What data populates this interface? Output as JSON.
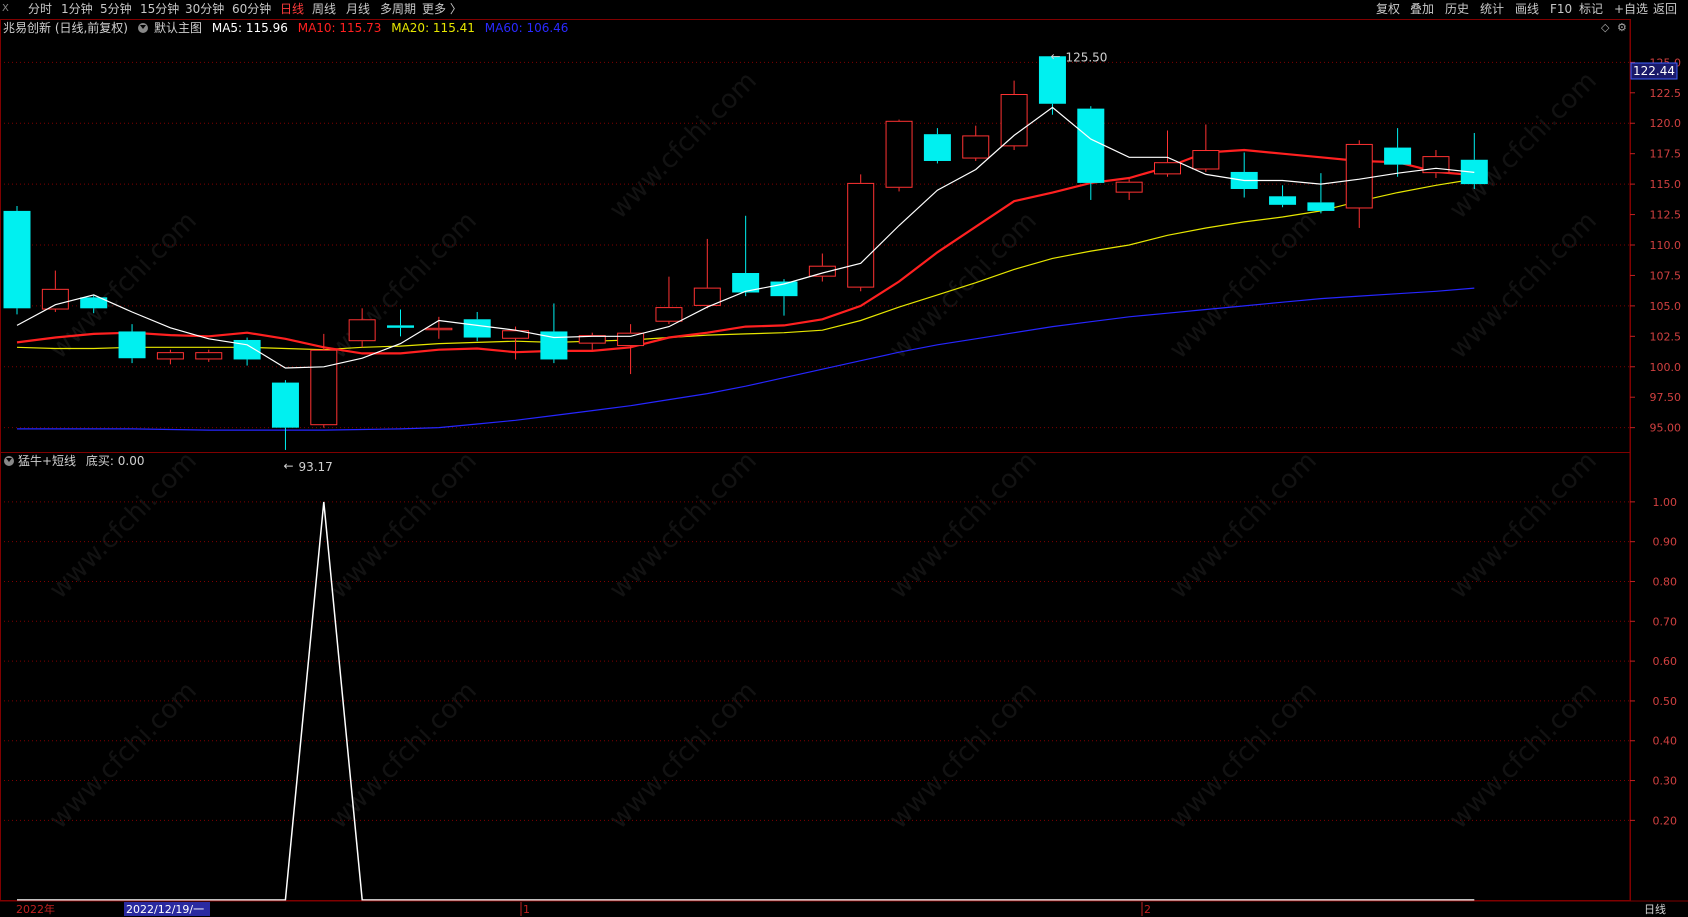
{
  "toolbar": {
    "corner": "X",
    "left_items": [
      "分时",
      "1分钟",
      "5分钟",
      "15分钟",
      "30分钟",
      "60分钟",
      "日线",
      "周线",
      "月线",
      "多周期",
      "更多 〉"
    ],
    "active": "日线",
    "right_items": [
      "复权",
      "叠加",
      "历史",
      "统计",
      "画线",
      "F10",
      "标记",
      "+自选",
      "返回"
    ]
  },
  "infobar": {
    "stock": "兆易创新 (日线,前复权)",
    "main": "默认主图",
    "ma5": "MA5: 115.96",
    "ma10": "MA10: 115.73",
    "ma20": "MA20: 115.41",
    "ma60": "MA60: 106.46"
  },
  "colors": {
    "up": "#ff3232",
    "down": "#00f0f0",
    "ma5": "#ffffff",
    "ma10": "#ff2020",
    "ma20": "#e6e600",
    "ma60": "#2626ff",
    "grid": "#800000",
    "indicator": "#ffffff"
  },
  "price_panel": {
    "current_price": "122.44",
    "high_label": "125.50",
    "low_label": "93.17",
    "yticks": [
      "125.0",
      "122.5",
      "120.0",
      "117.5",
      "115.0",
      "112.5",
      "110.0",
      "107.5",
      "105.0",
      "102.5",
      "100.0",
      "97.50",
      "95.00"
    ]
  },
  "indicator_panel": {
    "title": "猛牛+短线",
    "value": "底买: 0.00",
    "yticks": [
      "1.00",
      "0.90",
      "0.80",
      "0.70",
      "0.60",
      "0.50",
      "0.40",
      "0.30",
      "0.20"
    ]
  },
  "xaxis": {
    "year": "2022年",
    "cursor_date": "2022/12/19/一",
    "month1": "1",
    "month2": "2",
    "period": "日线"
  },
  "watermark": "www.cfchi.com",
  "chart_data": {
    "type": "candlestick",
    "ylim": [
      93.0,
      127.0
    ],
    "candles": [
      {
        "o": 112.8,
        "c": 104.8,
        "h": 113.2,
        "l": 104.3
      },
      {
        "o": 104.7,
        "c": 106.4,
        "h": 107.9,
        "l": 104.5
      },
      {
        "o": 105.7,
        "c": 104.8,
        "h": 105.9,
        "l": 104.4
      },
      {
        "o": 102.9,
        "c": 100.7,
        "h": 103.5,
        "l": 100.3
      },
      {
        "o": 100.6,
        "c": 101.2,
        "h": 101.4,
        "l": 100.2
      },
      {
        "o": 100.6,
        "c": 101.2,
        "h": 101.4,
        "l": 100.4
      },
      {
        "o": 102.2,
        "c": 100.6,
        "h": 102.4,
        "l": 100.1
      },
      {
        "o": 98.7,
        "c": 95.0,
        "h": 98.9,
        "l": 93.17
      },
      {
        "o": 95.2,
        "c": 101.4,
        "h": 102.7,
        "l": 95.0
      },
      {
        "o": 102.1,
        "c": 103.9,
        "h": 104.8,
        "l": 101.6
      },
      {
        "o": 103.4,
        "c": 103.2,
        "h": 104.7,
        "l": 102.5
      },
      {
        "o": 103.0,
        "c": 103.2,
        "h": 104.1,
        "l": 102.3
      },
      {
        "o": 103.9,
        "c": 102.4,
        "h": 104.5,
        "l": 102.1
      },
      {
        "o": 102.3,
        "c": 103.0,
        "h": 103.3,
        "l": 100.6
      },
      {
        "o": 102.9,
        "c": 100.6,
        "h": 105.2,
        "l": 100.3
      },
      {
        "o": 101.9,
        "c": 102.6,
        "h": 102.8,
        "l": 101.4
      },
      {
        "o": 101.7,
        "c": 102.8,
        "h": 103.5,
        "l": 99.4
      },
      {
        "o": 103.7,
        "c": 104.9,
        "h": 107.4,
        "l": 103.5
      },
      {
        "o": 105.0,
        "c": 106.5,
        "h": 110.5,
        "l": 104.8
      },
      {
        "o": 107.7,
        "c": 106.1,
        "h": 112.4,
        "l": 105.8
      },
      {
        "o": 107.0,
        "c": 105.8,
        "h": 107.2,
        "l": 104.2
      },
      {
        "o": 107.4,
        "c": 108.3,
        "h": 109.3,
        "l": 107.0
      },
      {
        "o": 106.5,
        "c": 115.1,
        "h": 115.8,
        "l": 106.2
      },
      {
        "o": 114.7,
        "c": 120.2,
        "h": 120.3,
        "l": 114.4
      },
      {
        "o": 119.1,
        "c": 116.9,
        "h": 119.6,
        "l": 116.7
      },
      {
        "o": 117.1,
        "c": 119.0,
        "h": 119.8,
        "l": 116.9
      },
      {
        "o": 118.1,
        "c": 122.4,
        "h": 123.5,
        "l": 117.8
      },
      {
        "o": 125.5,
        "c": 121.6,
        "h": 125.5,
        "l": 120.7
      },
      {
        "o": 121.2,
        "c": 115.1,
        "h": 121.4,
        "l": 113.7
      },
      {
        "o": 114.3,
        "c": 115.2,
        "h": 115.4,
        "l": 113.7
      },
      {
        "o": 115.8,
        "c": 116.8,
        "h": 119.4,
        "l": 115.6
      },
      {
        "o": 116.2,
        "c": 117.8,
        "h": 119.9,
        "l": 116.0
      },
      {
        "o": 116.0,
        "c": 114.6,
        "h": 117.6,
        "l": 113.9
      },
      {
        "o": 114.0,
        "c": 113.3,
        "h": 114.9,
        "l": 113.1
      },
      {
        "o": 113.5,
        "c": 112.8,
        "h": 115.9,
        "l": 112.6
      },
      {
        "o": 113.0,
        "c": 118.3,
        "h": 118.6,
        "l": 111.4
      },
      {
        "o": 118.0,
        "c": 116.6,
        "h": 119.6,
        "l": 115.6
      },
      {
        "o": 115.9,
        "c": 117.3,
        "h": 117.8,
        "l": 115.5
      },
      {
        "o": 117.0,
        "c": 115.0,
        "h": 119.2,
        "l": 114.6
      }
    ],
    "ma5": [
      103.4,
      105.1,
      105.9,
      104.5,
      103.2,
      102.3,
      101.8,
      99.9,
      100.0,
      100.7,
      101.9,
      103.8,
      103.4,
      103.0,
      102.4,
      102.5,
      102.5,
      103.3,
      104.9,
      106.2,
      106.8,
      107.7,
      108.5,
      111.6,
      114.5,
      116.2,
      119.0,
      121.3,
      118.7,
      117.2,
      117.2,
      115.8,
      115.3,
      115.3,
      115.0,
      115.4,
      115.9,
      116.3,
      115.96
    ],
    "ma10": [
      102.0,
      102.4,
      102.7,
      102.8,
      102.6,
      102.5,
      102.8,
      102.3,
      101.6,
      101.1,
      101.1,
      101.4,
      101.5,
      101.2,
      101.3,
      101.3,
      101.6,
      102.4,
      102.8,
      103.3,
      103.4,
      103.9,
      105.0,
      107.0,
      109.4,
      111.5,
      113.6,
      114.3,
      115.1,
      115.5,
      116.4,
      117.6,
      117.8,
      117.5,
      117.2,
      116.9,
      116.8,
      116.0,
      115.73
    ],
    "ma20": [
      101.6,
      101.5,
      101.5,
      101.6,
      101.6,
      101.6,
      101.6,
      101.5,
      101.4,
      101.6,
      101.7,
      101.9,
      102.0,
      102.1,
      102.0,
      102.1,
      102.2,
      102.4,
      102.6,
      102.7,
      102.8,
      103.0,
      103.8,
      104.9,
      105.9,
      106.9,
      108.0,
      108.9,
      109.5,
      110.0,
      110.8,
      111.4,
      111.9,
      112.3,
      112.8,
      113.6,
      114.3,
      114.9,
      115.41
    ],
    "ma60": [
      94.9,
      94.9,
      94.9,
      94.9,
      94.85,
      94.8,
      94.8,
      94.8,
      94.8,
      94.85,
      94.9,
      95.0,
      95.3,
      95.6,
      96.0,
      96.4,
      96.8,
      97.3,
      97.8,
      98.4,
      99.1,
      99.8,
      100.5,
      101.2,
      101.8,
      102.3,
      102.8,
      103.3,
      103.7,
      104.1,
      104.4,
      104.7,
      105.0,
      105.3,
      105.6,
      105.8,
      106.0,
      106.2,
      106.46
    ],
    "indicator": {
      "name": "底买",
      "ylim": [
        0.0,
        1.0
      ],
      "values": [
        0,
        0,
        0,
        0,
        0,
        0,
        0,
        0,
        1,
        0,
        0,
        0,
        0,
        0,
        0,
        0,
        0,
        0,
        0,
        0,
        0,
        0,
        0,
        0,
        0,
        0,
        0,
        0,
        0,
        0,
        0,
        0,
        0,
        0,
        0,
        0,
        0,
        0,
        0
      ]
    }
  }
}
